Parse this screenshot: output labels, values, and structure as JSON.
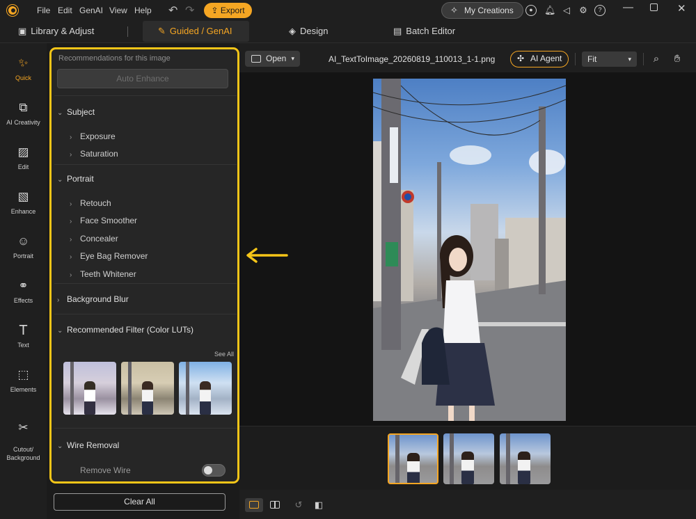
{
  "titlebar": {
    "menus": [
      "File",
      "Edit",
      "GenAI",
      "View",
      "Help"
    ],
    "export_label": "Export",
    "my_creations_label": "My Creations"
  },
  "tabs": [
    {
      "label": "Library & Adjust",
      "icon": "library-icon"
    },
    {
      "label": "Guided / GenAI",
      "icon": "magic-wand-icon",
      "active": true
    },
    {
      "label": "Design",
      "icon": "layers-icon"
    },
    {
      "label": "Batch Editor",
      "icon": "batch-icon"
    }
  ],
  "leftnav": [
    {
      "label": "Quick",
      "icon": "magic-wand-icon",
      "active": true
    },
    {
      "label": "AI Creativity",
      "icon": "ai-creativity-icon"
    },
    {
      "label": "Edit",
      "icon": "edit-icon"
    },
    {
      "label": "Enhance",
      "icon": "enhance-icon"
    },
    {
      "label": "Portrait",
      "icon": "portrait-icon"
    },
    {
      "label": "Effects",
      "icon": "effects-icon"
    },
    {
      "label": "Text",
      "icon": "text-icon"
    },
    {
      "label": "Elements",
      "icon": "elements-icon"
    },
    {
      "label": "Cutout/\nBackground",
      "icon": "cutout-icon"
    }
  ],
  "panel": {
    "recommendations_title": "Recommendations for this image",
    "auto_enhance_label": "Auto Enhance",
    "subject": {
      "title": "Subject",
      "items": [
        "Exposure",
        "Saturation"
      ]
    },
    "portrait": {
      "title": "Portrait",
      "items": [
        "Retouch",
        "Face Smoother",
        "Concealer",
        "Eye Bag Remover",
        "Teeth Whitener"
      ]
    },
    "background_blur": "Background Blur",
    "recommended_filter": "Recommended Filter (Color LUTs)",
    "see_all": "See All",
    "wire_removal": {
      "title": "Wire Removal",
      "remove_wire": "Remove Wire",
      "toggle_on": false
    }
  },
  "clear_all_label": "Clear All",
  "toolbar": {
    "open_label": "Open",
    "filename": "AI_TextToImage_20260819_110013_1-1.png",
    "ai_agent_label": "AI Agent",
    "zoom_value": "Fit"
  },
  "colors": {
    "accent": "#f5a623",
    "highlight_border": "#f5c518"
  }
}
